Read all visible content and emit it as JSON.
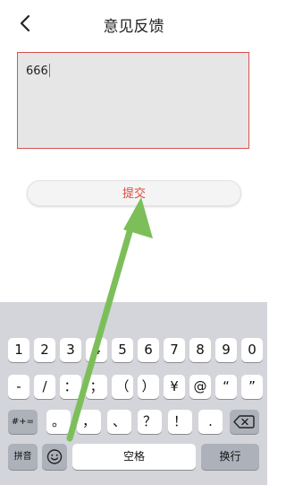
{
  "header": {
    "title": "意见反馈",
    "back_icon": "chevron-left-icon"
  },
  "feedback": {
    "value": "666"
  },
  "submit": {
    "label": "提交",
    "color": "#e0483e"
  },
  "keyboard": {
    "row1": [
      "1",
      "2",
      "3",
      "4",
      "5",
      "6",
      "7",
      "8",
      "9",
      "0"
    ],
    "row2": [
      "-",
      "/",
      "：",
      "；",
      "（",
      "）",
      "¥",
      "@",
      "“",
      "”"
    ],
    "row3_left": "#+=",
    "row3": [
      "。",
      "，",
      "、",
      "？",
      "！",
      "."
    ],
    "delete_icon": "backspace-icon",
    "row4": {
      "pinyin": "拼音",
      "emoji_icon": "emoji-icon",
      "space": "空格",
      "return": "换行"
    }
  },
  "annotation": {
    "arrow_color": "#7cbf5a"
  }
}
